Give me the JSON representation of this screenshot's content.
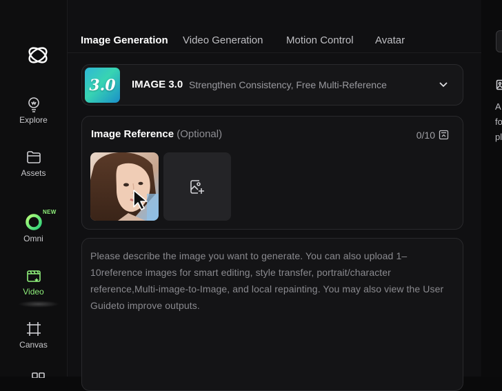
{
  "sidebar": {
    "items": [
      {
        "label": "Explore",
        "icon": "lightbulb-icon"
      },
      {
        "label": "Assets",
        "icon": "folder-icon"
      },
      {
        "label": "Omni",
        "icon": "omni-ring-icon",
        "badge": "NEW"
      },
      {
        "label": "Video",
        "icon": "video-clapper-icon",
        "active": true
      },
      {
        "label": "Canvas",
        "icon": "canvas-frame-icon"
      }
    ]
  },
  "tabs": [
    {
      "label": "Image Generation",
      "active": true
    },
    {
      "label": "Video Generation"
    },
    {
      "label": "Motion Control"
    },
    {
      "label": "Avatar"
    }
  ],
  "model": {
    "thumb_text": "3.0",
    "name": "IMAGE 3.0",
    "description": "Strengthen Consistency, Free Multi-Reference"
  },
  "reference": {
    "title": "Image Reference",
    "optional": "(Optional)",
    "count": "0/10"
  },
  "prompt": {
    "placeholder": "Please describe the image you want to generate. You can also upload 1–10reference images for smart editing, style transfer, portrait/character reference,Multi-image-to-Image, and local repainting. You may also view the User Guideto improve outputs."
  },
  "right_panel": {
    "text_lines": [
      "A",
      "fo",
      "pl"
    ]
  },
  "colors": {
    "accent": "#8ff07b",
    "background": "#0a0a0b",
    "card": "#141416"
  }
}
